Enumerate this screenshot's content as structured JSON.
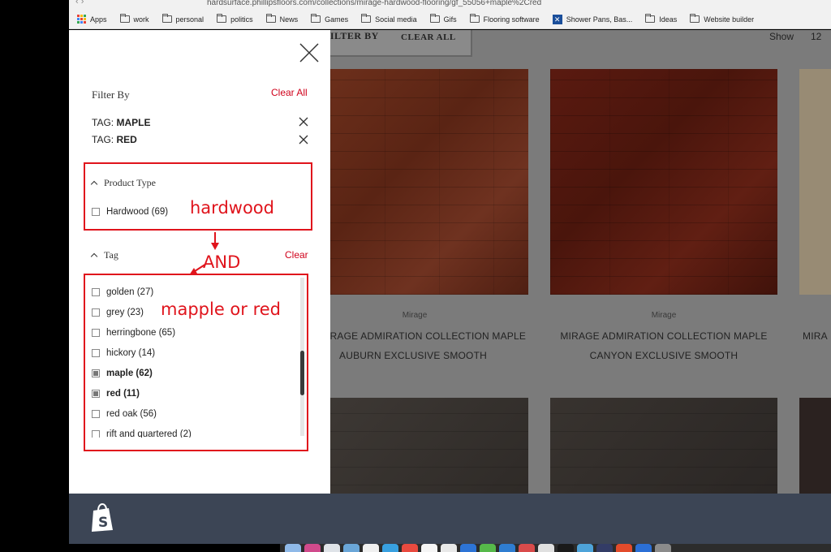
{
  "browser": {
    "url": "hardsurface.phillipsfloors.com/collections/mirage-hardwood-flooring/gf_55056+maple%2Cred",
    "bookmarks": [
      {
        "label": "Apps",
        "icon": "apps-grid-icon"
      },
      {
        "label": "work",
        "icon": "folder-icon"
      },
      {
        "label": "personal",
        "icon": "folder-icon"
      },
      {
        "label": "politics",
        "icon": "folder-icon"
      },
      {
        "label": "News",
        "icon": "folder-icon"
      },
      {
        "label": "Games",
        "icon": "folder-icon"
      },
      {
        "label": "Social media",
        "icon": "folder-icon"
      },
      {
        "label": "Gifs",
        "icon": "folder-icon"
      },
      {
        "label": "Flooring software",
        "icon": "folder-icon"
      },
      {
        "label": "Shower Pans, Bas...",
        "icon": "x-site-icon"
      },
      {
        "label": "Ideas",
        "icon": "folder-icon"
      },
      {
        "label": "Website builder",
        "icon": "folder-icon"
      }
    ]
  },
  "store": {
    "filter_by": "FILTER BY",
    "clear_all": "CLEAR ALL",
    "show_label": "Show",
    "show_value": "12",
    "products": [
      {
        "vendor": "Mirage",
        "title_line1": "IRAGE ADMIRATION COLLECTION MAPLE",
        "title_line2": "AUBURN EXCLUSIVE SMOOTH"
      },
      {
        "vendor": "Mirage",
        "title_line1": "MIRAGE ADMIRATION COLLECTION MAPLE",
        "title_line2": "CANYON EXCLUSIVE SMOOTH"
      },
      {
        "vendor": "",
        "title_line1": "MIRA",
        "title_line2": ""
      }
    ]
  },
  "panel": {
    "filter_by": "Filter By",
    "clear_all": "Clear All",
    "active_tags": [
      {
        "prefix": "TAG: ",
        "value": "MAPLE"
      },
      {
        "prefix": "TAG: ",
        "value": "RED"
      }
    ],
    "product_type": {
      "title": "Product Type",
      "options": [
        {
          "label": "Hardwood (69)",
          "checked": false
        }
      ]
    },
    "tag": {
      "title": "Tag",
      "clear": "Clear",
      "options": [
        {
          "label": "golden (27)",
          "checked": false
        },
        {
          "label": "grey (23)",
          "checked": false
        },
        {
          "label": "herringbone (65)",
          "checked": false
        },
        {
          "label": "hickory (14)",
          "checked": false
        },
        {
          "label": "maple (62)",
          "checked": true
        },
        {
          "label": "red (11)",
          "checked": true
        },
        {
          "label": "red oak (56)",
          "checked": false
        },
        {
          "label": "rift and quartered (2)",
          "checked": false
        }
      ]
    }
  },
  "annotations": {
    "hardwood": "hardwood",
    "and": "AND",
    "maple_or_red": "mapple or red",
    "color": "#e0141c"
  }
}
